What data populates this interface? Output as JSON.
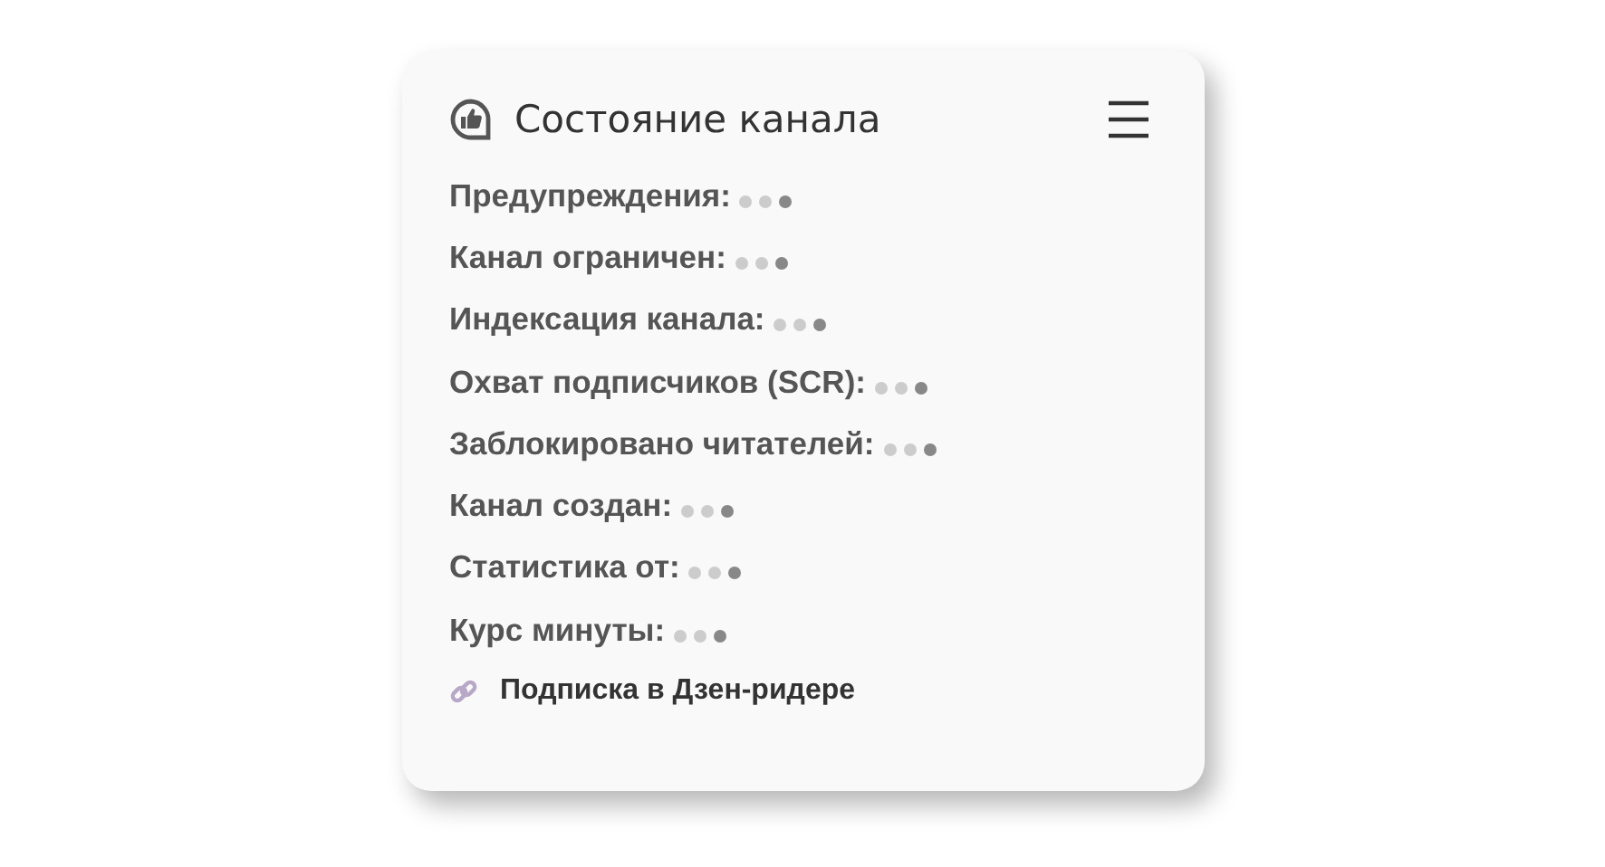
{
  "card": {
    "title": "Состояние канала",
    "fields": [
      {
        "label": "Предупреждения:",
        "loading": true
      },
      {
        "label": "Канал ограничен:",
        "loading": true
      },
      {
        "label": "Индексация канала:",
        "loading": true
      },
      {
        "label": "Охват подписчиков (SCR):",
        "loading": true
      },
      {
        "label": "Заблокировано читателей:",
        "loading": true
      },
      {
        "label": "Канал создан:",
        "loading": true
      },
      {
        "label": "Статистика от:",
        "loading": true
      },
      {
        "label": "Курс минуты:",
        "loading": true
      }
    ],
    "link": {
      "text": "Подписка в Дзен-ридере"
    }
  }
}
